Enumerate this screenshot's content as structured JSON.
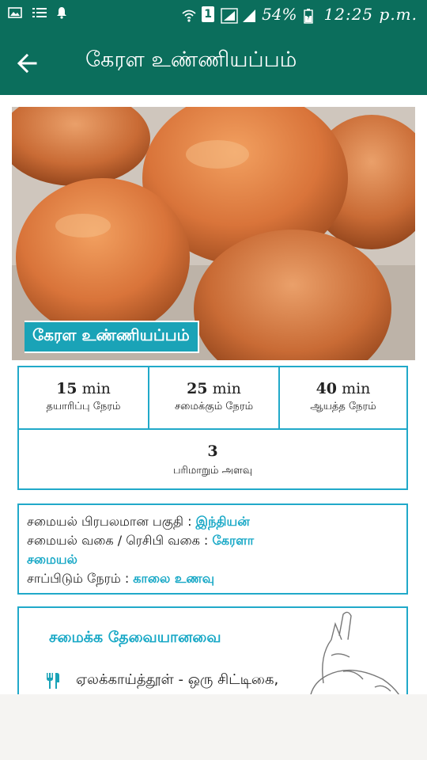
{
  "status_bar": {
    "battery_percent": "54%",
    "time": "12:25 p.m.",
    "sim_label": "1"
  },
  "app_bar": {
    "title": "கேரள உண்ணியப்பம்"
  },
  "recipe": {
    "image_caption": "கேரள உண்ணியப்பம்",
    "prep": {
      "value": "15",
      "unit": "min",
      "label": "தயாரிப்பு நேரம்"
    },
    "cook": {
      "value": "25",
      "unit": "min",
      "label": "சமைக்கும் நேரம்"
    },
    "ready": {
      "value": "40",
      "unit": "min",
      "label": "ஆயத்த நேரம்"
    },
    "servings": {
      "value": "3",
      "label": "பரிமாறும் அளவு"
    }
  },
  "info": {
    "cuisine_label": "சமையல் பிரபலமான பகுதி : ",
    "cuisine_value": "இந்தியன்",
    "category_label": "சமையல் வகை / ரெசிபி வகை : ",
    "category_value_1": "கேரளா",
    "category_value_2": "சமையல்",
    "meal_label": "சாப்பிடும் நேரம் : ",
    "meal_value": "காலை உணவு"
  },
  "ingredients": {
    "title": "சமைக்க தேவையானவை",
    "items": [
      "ஏலக்காய்த்தூள் - ஒரு சிட்டிகை,"
    ]
  }
}
